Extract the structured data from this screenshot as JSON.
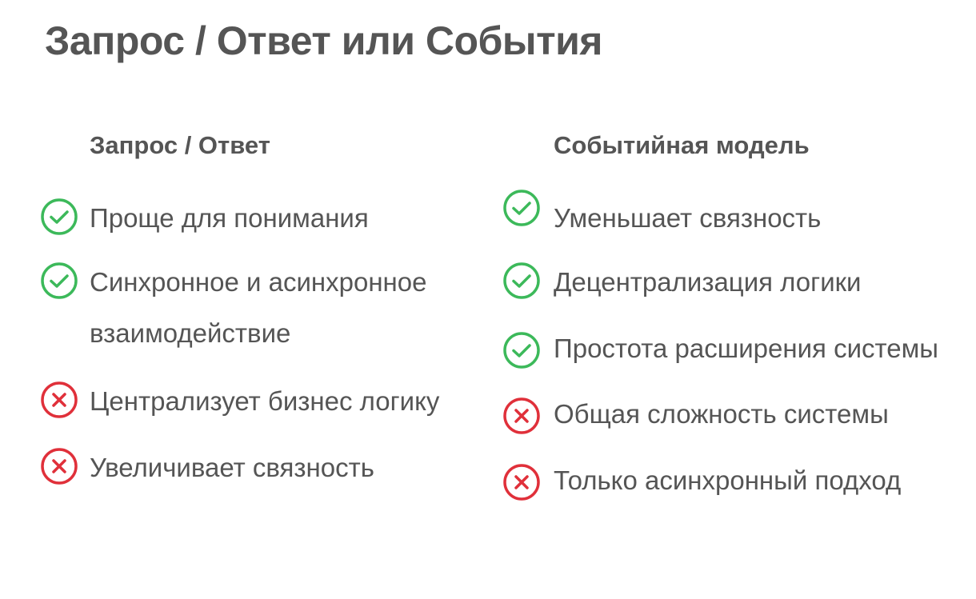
{
  "title": "Запрос / Ответ или События",
  "colors": {
    "text": "#555555",
    "pro": "#3cb95a",
    "con": "#e0303a"
  },
  "left": {
    "heading": "Запрос / Ответ",
    "items": [
      {
        "text": "Проще для понимания",
        "kind": "pro",
        "icon": "check-circle-icon"
      },
      {
        "text": "Синхронное и асинхронное взаимодействие",
        "kind": "pro",
        "icon": "check-circle-icon"
      },
      {
        "text": "Централизует бизнес логику",
        "kind": "con",
        "icon": "cross-circle-icon"
      },
      {
        "text": "Увеличивает связность",
        "kind": "con",
        "icon": "cross-circle-icon"
      }
    ]
  },
  "right": {
    "heading": "Событийная модель",
    "items": [
      {
        "text": "Уменьшает связность",
        "kind": "pro",
        "icon": "check-circle-icon"
      },
      {
        "text": "Децентрализация логики",
        "kind": "pro",
        "icon": "check-circle-icon"
      },
      {
        "text": "Простота расширения системы",
        "kind": "pro",
        "icon": "check-circle-icon"
      },
      {
        "text": "Общая сложность системы",
        "kind": "con",
        "icon": "cross-circle-icon"
      },
      {
        "text": "Только асинхронный подход",
        "kind": "con",
        "icon": "cross-circle-icon"
      }
    ]
  }
}
